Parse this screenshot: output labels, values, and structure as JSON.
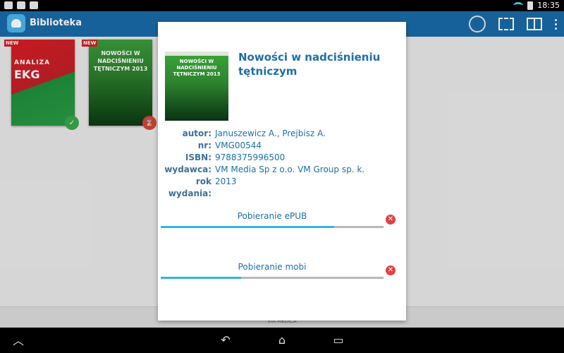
{
  "status": {
    "time": "18:35"
  },
  "appbar": {
    "title": "Biblioteka"
  },
  "books": [
    {
      "badge": "NEW",
      "title_top": "ANALIZA",
      "title_main": "EKG"
    },
    {
      "badge": "NEW",
      "title": "NOWOŚCI W NADCIŚNIENIU TĘTNICZYM 2013"
    }
  ],
  "footer": {
    "text": "VIA MEDICA"
  },
  "dialog": {
    "title": "Nowości w nadciśnieniu tętniczym",
    "cover_title": "NOWOŚCI W NADCIŚNIENIU TĘTNICZYM 2013",
    "fields": [
      {
        "label": "autor:",
        "value": "Januszewicz A., Prejbisz A."
      },
      {
        "label": "nr:",
        "value": "VMG00544"
      },
      {
        "label": "ISBN:",
        "value": "9788375996500"
      },
      {
        "label": "wydawca:",
        "value": "VM Media Sp z o.o. VM Group sp. k."
      },
      {
        "label": "rok wydania:",
        "value": "2013"
      }
    ],
    "downloads": [
      {
        "label": "Pobieranie ePUB",
        "progress": 0.78
      },
      {
        "label": "Pobieranie mobi",
        "progress": 0.36
      }
    ]
  },
  "colors": {
    "actionbar": "#1a6aa8",
    "accent": "#33b5e5",
    "cancel": "#e14040"
  }
}
